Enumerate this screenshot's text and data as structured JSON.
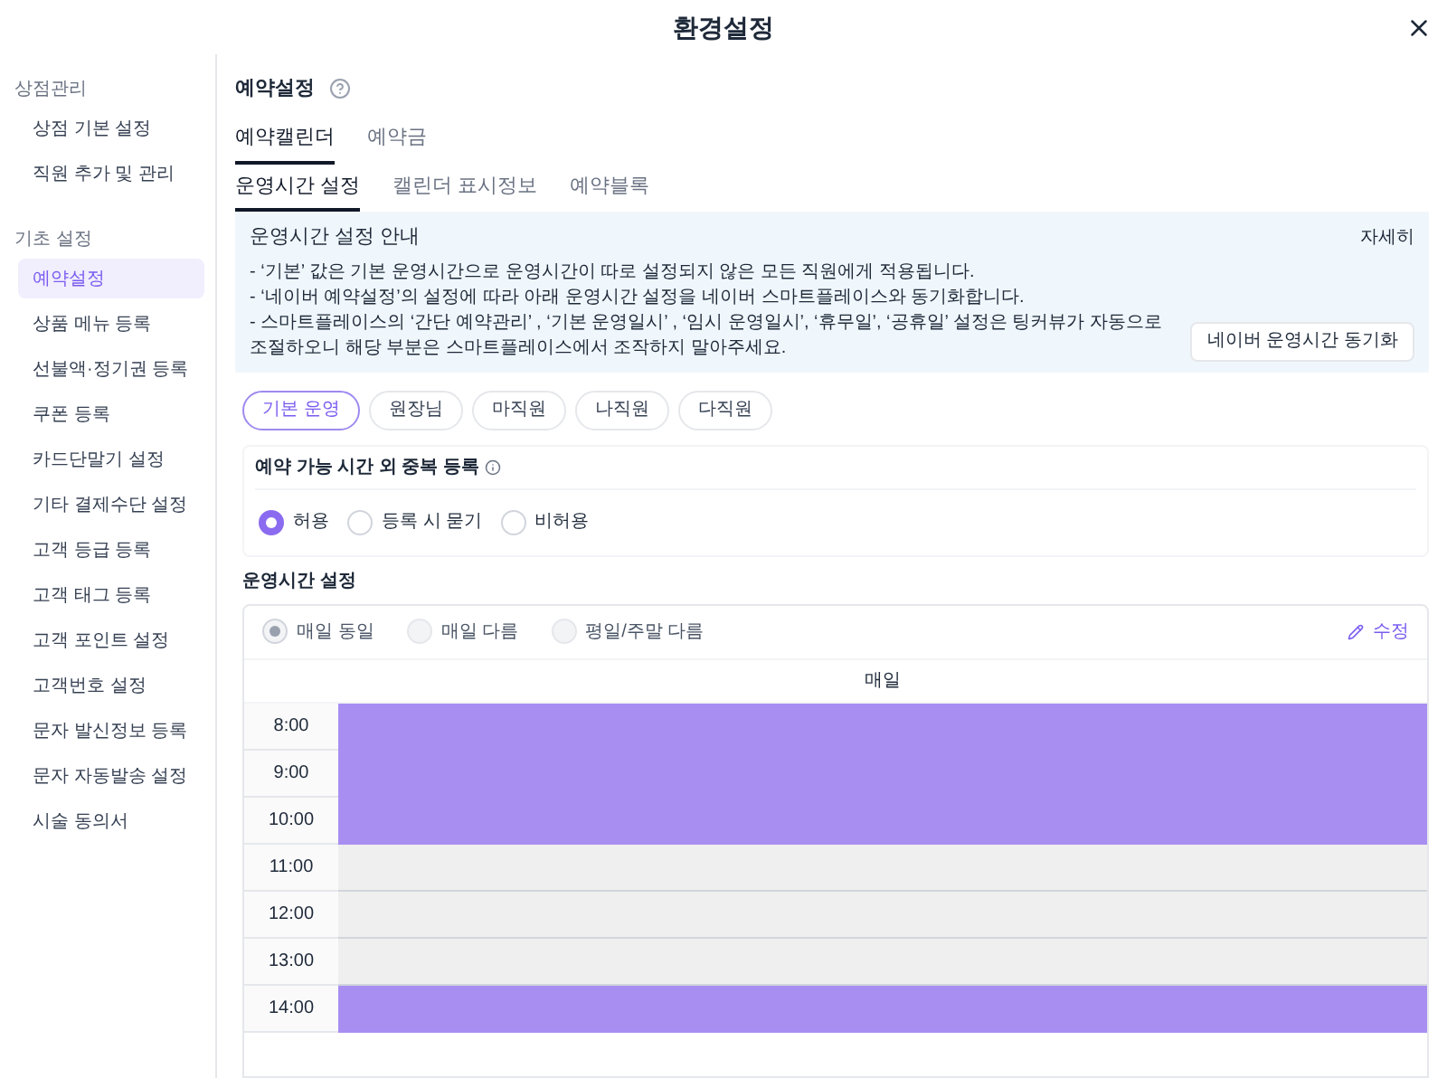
{
  "window": {
    "title": "환경설정"
  },
  "sidebar": {
    "groups": [
      {
        "title": "상점관리",
        "items": [
          {
            "label": "상점 기본 설정",
            "selected": false
          },
          {
            "label": "직원 추가 및 관리",
            "selected": false
          }
        ]
      },
      {
        "title": "기초 설정",
        "items": [
          {
            "label": "예약설정",
            "selected": true
          },
          {
            "label": "상품 메뉴 등록",
            "selected": false
          },
          {
            "label": "선불액·정기권 등록",
            "selected": false
          },
          {
            "label": "쿠폰 등록",
            "selected": false
          },
          {
            "label": "카드단말기 설정",
            "selected": false
          },
          {
            "label": "기타 결제수단 설정",
            "selected": false
          },
          {
            "label": "고객 등급 등록",
            "selected": false
          },
          {
            "label": "고객 태그 등록",
            "selected": false
          },
          {
            "label": "고객 포인트 설정",
            "selected": false
          },
          {
            "label": "고객번호 설정",
            "selected": false
          },
          {
            "label": "문자 발신정보 등록",
            "selected": false
          },
          {
            "label": "문자 자동발송 설정",
            "selected": false
          },
          {
            "label": "시술 동의서",
            "selected": false
          }
        ]
      }
    ]
  },
  "page_title": "예약설정",
  "tabs": [
    {
      "label": "예약캘린더",
      "selected": true
    },
    {
      "label": "예약금",
      "selected": false
    }
  ],
  "subtabs": [
    {
      "label": "운영시간 설정",
      "selected": true
    },
    {
      "label": "캘린더 표시정보",
      "selected": false
    },
    {
      "label": "예약블록",
      "selected": false
    }
  ],
  "notice": {
    "title": "운영시간 설정 안내",
    "link": "자세히",
    "lines": [
      "- ‘기본’ 값은 기본 운영시간으로 운영시간이 따로 설정되지 않은 모든 직원에게 적용됩니다.",
      "- ‘네이버 예약설정’의 설정에 따라 아래 운영시간 설정을 네이버 스마트플레이스와 동기화합니다.",
      "- 스마트플레이스의 ‘간단 예약관리’ , ‘기본 운영일시’ , ‘임시 운영일시’, ‘휴무일’, ‘공휴일’ 설정은 팅커뷰가 자동으로 조절하오니 해당 부분은 스마트플레이스에서 조작하지 말아주세요."
    ],
    "button": "네이버 운영시간 동기화"
  },
  "staff": [
    {
      "label": "기본 운영",
      "selected": true
    },
    {
      "label": "원장님",
      "selected": false
    },
    {
      "label": "마직원",
      "selected": false
    },
    {
      "label": "나직원",
      "selected": false
    },
    {
      "label": "다직원",
      "selected": false
    }
  ],
  "overlap": {
    "title": "예약 가능 시간 외 중복 등록",
    "options": [
      {
        "label": "허용",
        "selected": true
      },
      {
        "label": "등록 시 묻기",
        "selected": false
      },
      {
        "label": "비허용",
        "selected": false
      }
    ]
  },
  "hours": {
    "title": "운영시간 설정",
    "options": [
      {
        "label": "매일 동일",
        "selected": true
      },
      {
        "label": "매일 다름",
        "selected": false
      },
      {
        "label": "평일/주말 다름",
        "selected": false
      }
    ],
    "edit": "수정",
    "column": "매일",
    "rows": [
      {
        "time": "8:00",
        "open": true
      },
      {
        "time": "9:00",
        "open": true
      },
      {
        "time": "10:00",
        "open": true
      },
      {
        "time": "11:00",
        "open": false
      },
      {
        "time": "12:00",
        "open": false
      },
      {
        "time": "13:00",
        "open": false
      },
      {
        "time": "14:00",
        "open": true
      }
    ]
  }
}
